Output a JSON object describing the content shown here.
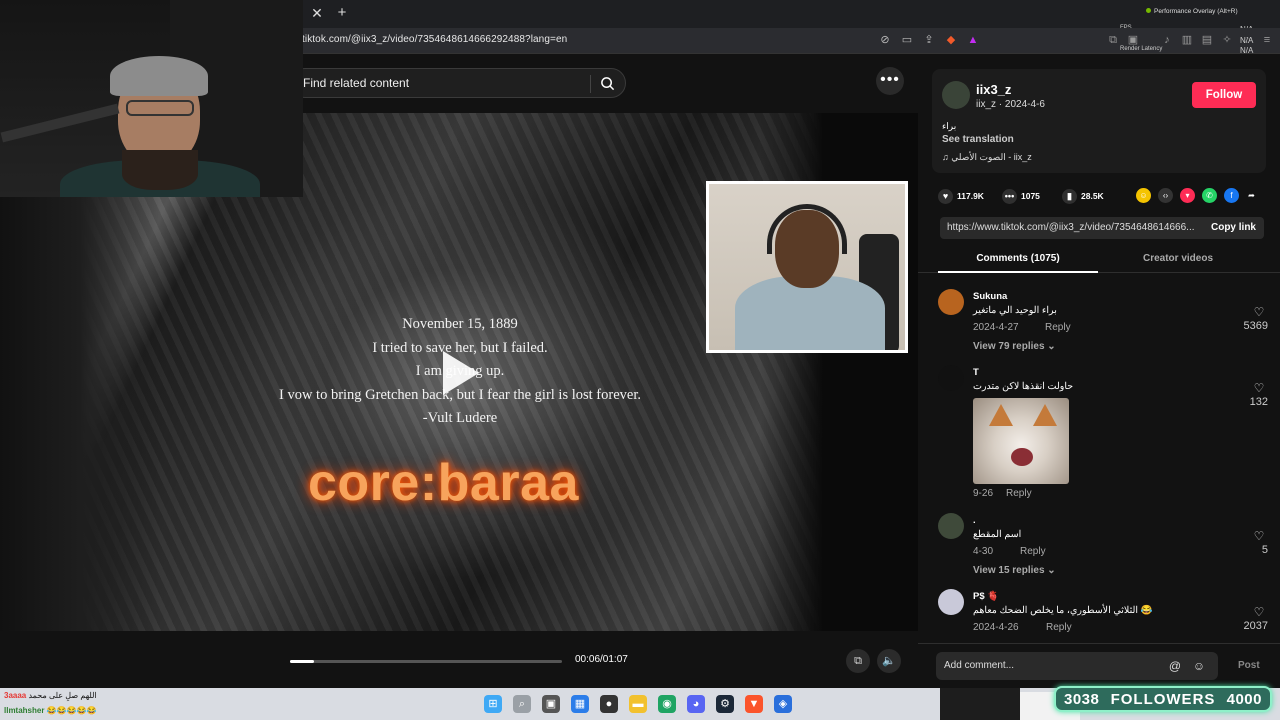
{
  "browser": {
    "url": "tiktok.com/@iix3_z/video/7354648614666292488?lang=en",
    "tab_close_icon": "close-icon",
    "new_tab_icon": "plus-icon",
    "overlay": {
      "performance": "Performance Overlay (Alt+R)",
      "fps_label": "FPS",
      "render_latency_label": "Render Latency",
      "na_values": [
        "N/A",
        "N/A",
        "N/A"
      ]
    }
  },
  "search": {
    "placeholder": "Find related content",
    "icon": "search-icon"
  },
  "video": {
    "poem_lines": [
      "November 15, 1889",
      "I tried to save her, but I failed.",
      "I am giving up.",
      "I vow to bring Gretchen back, but I fear the girl is lost forever.",
      "-Vult Ludere"
    ],
    "overlay_text": "core:baraa",
    "time": "00:06/01:07",
    "progress_fraction": 0.09
  },
  "author": {
    "username": "iix3_z",
    "handle_date": "iix_z · 2024-4-6",
    "follow_label": "Follow",
    "description": "براء",
    "see_translation": "See translation",
    "music": "♫  الصوت الأصلي - iix_z"
  },
  "stats": {
    "likes": "117.9K",
    "comments": "1075",
    "saves": "28.5K"
  },
  "link": {
    "url": "https://www.tiktok.com/@iix3_z/video/7354648614666...",
    "copy_label": "Copy link"
  },
  "tabs": {
    "comments": "Comments (1075)",
    "creator": "Creator videos"
  },
  "comments": [
    {
      "name": "Sukuna",
      "text": "براء الوحيد الي ماتغير",
      "date": "2024-4-27",
      "reply": "Reply",
      "likes": "5369",
      "view_replies": "View 79 replies ⌄",
      "avatar_color": "#b8641f"
    },
    {
      "name": "T",
      "text": "حاولت انقذها لاكن متدرت",
      "date": "9-26",
      "reply": "Reply",
      "likes": "132",
      "avatar_color": "#111111"
    },
    {
      "name": ".",
      "text": "اسم المقطع",
      "date": "4-30",
      "reply": "Reply",
      "likes": "5",
      "view_replies": "View 15 replies ⌄",
      "avatar_color": "#3f4a3a"
    },
    {
      "name": "P$ 🫀",
      "text": "الثلاثي الأسطوري، ما يخلص الضحك معاهم 😂",
      "date": "2024-4-26",
      "reply": "Reply",
      "likes": "2037",
      "avatar_color": "#c9c9d9"
    }
  ],
  "add_comment": {
    "placeholder": "Add comment...",
    "post": "Post"
  },
  "stream": {
    "chat_line1_user": "3aaaa",
    "chat_line1_text": "اللهم صلِ على محمد",
    "chat_line2_user": "llmtahsher",
    "chat_line2_text": "😂😂😂😂😂",
    "followers_current": "3038",
    "followers_label": "FOLLOWERS",
    "followers_goal": "4000"
  },
  "colors": {
    "follow": "#fe2c55",
    "overlay_text": "#f7a35c",
    "follower_bar": "#2e6b5c"
  }
}
